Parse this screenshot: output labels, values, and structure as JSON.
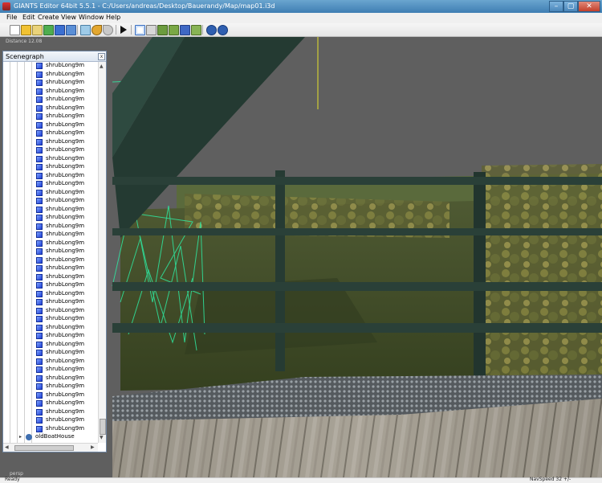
{
  "window": {
    "title": "GIANTS Editor 64bit 5.5.1 - C:/Users/andreas/Desktop/Bauerandy/Map/map01.i3d",
    "buttons": [
      "–",
      "▢",
      "✕"
    ]
  },
  "menu": [
    "File",
    "Edit",
    "Create",
    "View",
    "Window",
    "Help"
  ],
  "viewport": {
    "distance_label": "Distance 12.08",
    "camera_label": "persp"
  },
  "scenegraph": {
    "title": "Scenegraph",
    "items": [
      "shrubLong9m",
      "shrubLong9m",
      "shrubLong9m",
      "shrubLong9m",
      "shrubLong9m",
      "shrubLong9m",
      "shrubLong9m",
      "shrubLong9m",
      "shrubLong9m",
      "shrubLong9m",
      "shrubLong9m",
      "shrubLong9m",
      "shrubLong9m",
      "shrubLong9m",
      "shrubLong9m",
      "shrubLong9m",
      "shrubLong9m",
      "shrubLong9m",
      "shrubLong9m",
      "shrubLong9m",
      "shrubLong9m",
      "shrubLong9m",
      "shrubLong9m",
      "shrubLong9m",
      "shrubLong9m",
      "shrubLong9m",
      "shrubLong9m",
      "shrubLong9m",
      "shrubLong9m",
      "shrubLong9m",
      "shrubLong9m",
      "shrubLong9m",
      "shrubLong9m",
      "shrubLong9m",
      "shrubLong9m",
      "shrubLong9m",
      "shrubLong9m",
      "shrubLong9m",
      "shrubLong9m",
      "shrubLong9m",
      "shrubLong9m",
      "shrubLong9m",
      "shrubLong9m",
      "shrubLong9m"
    ],
    "last_item": "oldBoatHouse"
  },
  "status": {
    "left": "Ready",
    "right": "NavSpeed 32 +/-"
  },
  "colors": {
    "titlebar": "#4a86ba",
    "menubar": "#f0f0f0",
    "sky": "#5d5d5d",
    "railing": "#273730",
    "wireframe": "#2ee8a0",
    "node_cube": "#2a4fe0"
  }
}
